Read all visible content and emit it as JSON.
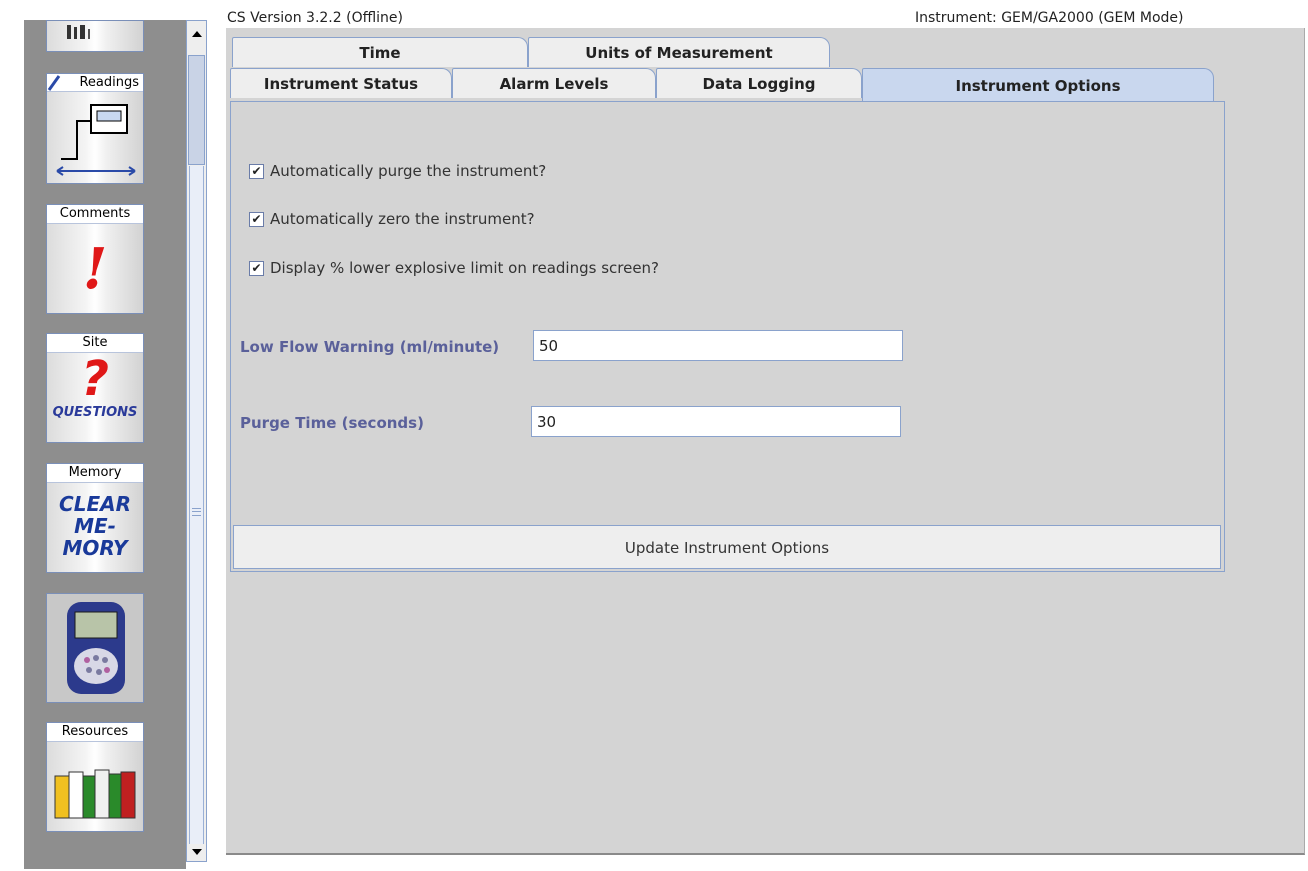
{
  "header": {
    "version": "CS Version 3.2.2 (Offline)",
    "instrument": "Instrument: GEM/GA2000 (GEM Mode)"
  },
  "sidebar": {
    "items": [
      {
        "label": "Readings",
        "icon": "readings-chart-icon"
      },
      {
        "label": "Comments",
        "icon": "exclamation-icon",
        "glyph": "!"
      },
      {
        "label": "Site",
        "icon": "question-icon",
        "glyph": "?",
        "caption": "QUESTIONS"
      },
      {
        "label": "Memory",
        "icon": "clear-memory-icon",
        "caption_line1": "CLEAR",
        "caption_line2": "ME-MORY"
      },
      {
        "label": "",
        "icon": "gas-analyser-device-icon"
      },
      {
        "label": "Resources",
        "icon": "books-icon"
      }
    ]
  },
  "tabs": {
    "row1": [
      "Time",
      "Units of Measurement"
    ],
    "row2": [
      "Instrument Status",
      "Alarm Levels",
      "Data Logging",
      "Instrument Options"
    ],
    "active": "Instrument Options"
  },
  "options": {
    "checks": [
      {
        "label": "Automatically purge the instrument?",
        "checked": true
      },
      {
        "label": "Automatically zero the instrument?",
        "checked": true
      },
      {
        "label": "Display % lower explosive limit on readings screen?",
        "checked": true
      }
    ],
    "low_flow": {
      "label": "Low Flow Warning (ml/minute)",
      "value": "50"
    },
    "purge_time": {
      "label": "Purge Time (seconds)",
      "value": "30"
    },
    "update_button": "Update Instrument Options"
  },
  "colors": {
    "active_tab": "#c9d7ee",
    "field_label": "#5a609a",
    "panel": "#d4d4d4",
    "sidebar": "#8e8e8e"
  }
}
